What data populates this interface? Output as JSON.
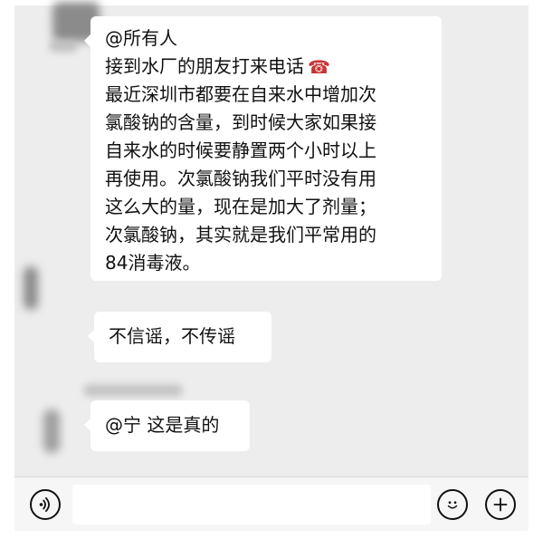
{
  "messages": [
    {
      "lines": [
        "@所有人",
        "接到水厂的朋友打来电话",
        "最近深圳市都要在自来水中增加次",
        "氯酸钠的含量，到时候大家如果接",
        "自来水的时候要静置两个小时以上",
        "再使用。次氯酸钠我们平时没有用",
        "这么大的量，现在是加大了剂量；",
        "次氯酸钠，其实就是我们平常用的",
        "84消毒液。"
      ],
      "emoji": "☎"
    },
    {
      "text": "不信谣，不传谣"
    },
    {
      "text": "@宁 这是真的"
    }
  ],
  "input": {
    "value": ""
  },
  "icons": {
    "voice": "voice-icon",
    "emoji": "emoji-icon",
    "add": "add-icon"
  },
  "colors": {
    "chat_background": "#ededed",
    "bubble": "#ffffff",
    "text": "#111111",
    "bottom_bar": "#f6f6f6"
  }
}
